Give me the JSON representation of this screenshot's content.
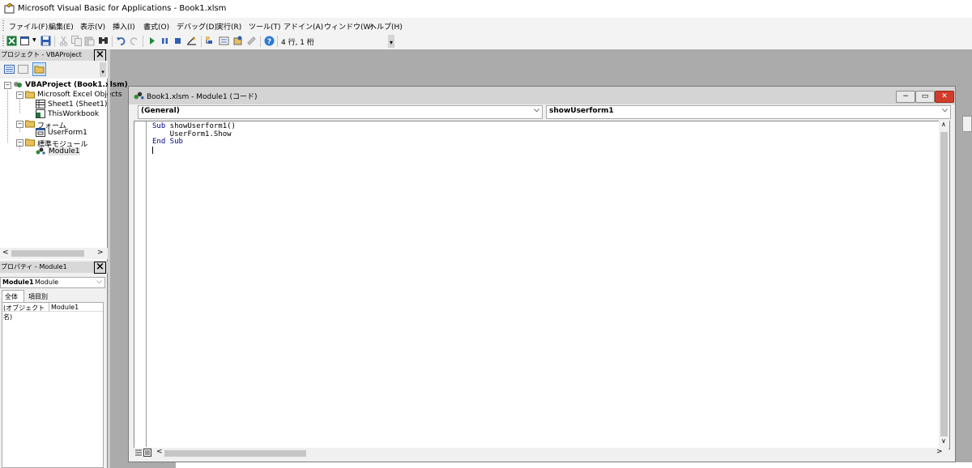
{
  "window": {
    "title": "Microsoft Visual Basic for Applications - Book1.xlsm"
  },
  "menu": [
    {
      "label": "ファイル(F)"
    },
    {
      "label": "編集(E)"
    },
    {
      "label": "表示(V)"
    },
    {
      "label": "挿入(I)"
    },
    {
      "label": "書式(O)"
    },
    {
      "label": "デバッグ(D)"
    },
    {
      "label": "実行(R)"
    },
    {
      "label": "ツール(T)"
    },
    {
      "label": "アドイン(A)"
    },
    {
      "label": "ウィンドウ(W)"
    },
    {
      "label": "ヘルプ(H)"
    }
  ],
  "toolbar": {
    "cursor_position": "4 行, 1 桁"
  },
  "project_pane": {
    "title": "プロジェクト - VBAProject",
    "tree": {
      "root": "VBAProject (Book1.xlsm)",
      "excel_objects_folder": "Microsoft Excel Objects",
      "sheet1": "Sheet1 (Sheet1)",
      "thisworkbook": "ThisWorkbook",
      "forms_folder": "フォーム",
      "userform1": "UserForm1",
      "modules_folder": "標準モジュール",
      "module1": "Module1"
    }
  },
  "properties_pane": {
    "title": "プロパティ - Module1",
    "object_name": "Module1",
    "object_type": "Module",
    "tab_all": "全体",
    "tab_category": "項目別",
    "prop_name": "(オブジェクト名)",
    "prop_value": "Module1"
  },
  "code_window": {
    "title": "Book1.xlsm - Module1 (コード)",
    "object_combo": "(General)",
    "procedure_combo": "showUserform1",
    "lines": {
      "l1_kw": "Sub",
      "l1_rest": " showUserform1()",
      "l2": "    UserForm1.Show",
      "l3_kw": "End Sub"
    }
  }
}
